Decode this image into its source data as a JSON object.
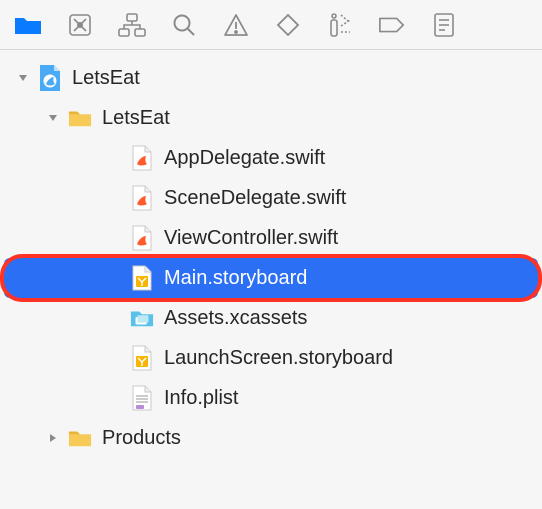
{
  "toolbar": {
    "icons": [
      "folder",
      "version-control",
      "hierarchy",
      "search",
      "warning",
      "diamond",
      "spray",
      "tag",
      "list"
    ]
  },
  "tree": [
    {
      "level": 0,
      "disc": "down",
      "icon": "app",
      "label": "LetsEat",
      "selected": false
    },
    {
      "level": 1,
      "disc": "down",
      "icon": "folder",
      "label": "LetsEat",
      "selected": false
    },
    {
      "level": 2,
      "disc": "none",
      "icon": "swift",
      "label": "AppDelegate.swift",
      "selected": false
    },
    {
      "level": 2,
      "disc": "none",
      "icon": "swift",
      "label": "SceneDelegate.swift",
      "selected": false
    },
    {
      "level": 2,
      "disc": "none",
      "icon": "swift",
      "label": "ViewController.swift",
      "selected": false
    },
    {
      "level": 2,
      "disc": "none",
      "icon": "storyboard",
      "label": "Main.storyboard",
      "selected": true,
      "highlight": true
    },
    {
      "level": 2,
      "disc": "none",
      "icon": "assets",
      "label": "Assets.xcassets",
      "selected": false
    },
    {
      "level": 2,
      "disc": "none",
      "icon": "storyboard",
      "label": "LaunchScreen.storyboard",
      "selected": false
    },
    {
      "level": 2,
      "disc": "none",
      "icon": "plist",
      "label": "Info.plist",
      "selected": false
    },
    {
      "level": 1,
      "disc": "right",
      "icon": "folder",
      "label": "Products",
      "selected": false
    }
  ]
}
